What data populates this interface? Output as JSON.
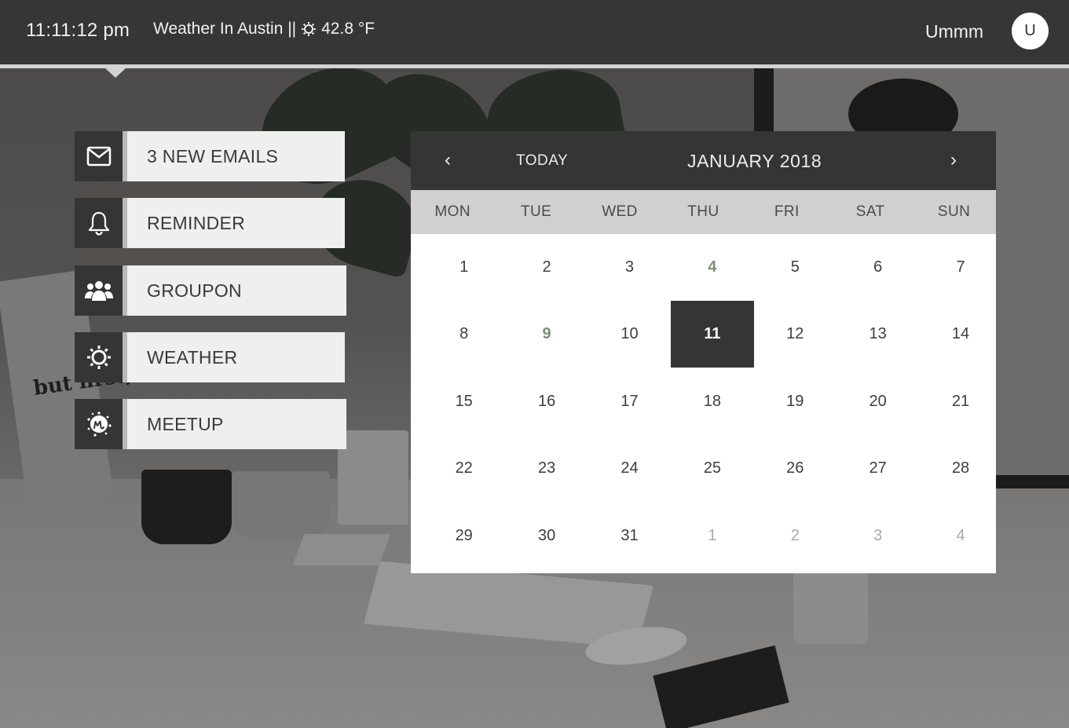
{
  "topbar": {
    "time": "11:11:12 pm",
    "weather_label": "Weather In Austin ||",
    "weather_icon": "sun-icon",
    "temperature": "42.8 °F",
    "user_name": "Ummm",
    "avatar_initial": "U"
  },
  "tiles": [
    {
      "label": "3 NEW EMAILS",
      "icon": "envelope-icon"
    },
    {
      "label": "REMINDER",
      "icon": "bell-icon"
    },
    {
      "label": "GROUPON",
      "icon": "group-icon"
    },
    {
      "label": "WEATHER",
      "icon": "sun-icon"
    },
    {
      "label": "MEETUP",
      "icon": "meetup-icon"
    }
  ],
  "calendar": {
    "prev_label": "‹",
    "today_label": "TODAY",
    "month_label": "JANUARY 2018",
    "next_label": "›",
    "weekdays": [
      "MON",
      "TUE",
      "WED",
      "THU",
      "FRI",
      "SAT",
      "SUN"
    ],
    "weeks": [
      [
        {
          "d": "1"
        },
        {
          "d": "2"
        },
        {
          "d": "3"
        },
        {
          "d": "4",
          "s": "event"
        },
        {
          "d": "5"
        },
        {
          "d": "6"
        },
        {
          "d": "7"
        }
      ],
      [
        {
          "d": "8"
        },
        {
          "d": "9",
          "s": "event"
        },
        {
          "d": "10"
        },
        {
          "d": "11",
          "s": "selected"
        },
        {
          "d": "12"
        },
        {
          "d": "13"
        },
        {
          "d": "14"
        }
      ],
      [
        {
          "d": "15"
        },
        {
          "d": "16"
        },
        {
          "d": "17"
        },
        {
          "d": "18"
        },
        {
          "d": "19"
        },
        {
          "d": "20"
        },
        {
          "d": "21"
        }
      ],
      [
        {
          "d": "22"
        },
        {
          "d": "23"
        },
        {
          "d": "24"
        },
        {
          "d": "25"
        },
        {
          "d": "26"
        },
        {
          "d": "27"
        },
        {
          "d": "28"
        }
      ],
      [
        {
          "d": "29"
        },
        {
          "d": "30"
        },
        {
          "d": "31"
        },
        {
          "d": "1",
          "s": "other"
        },
        {
          "d": "2",
          "s": "other"
        },
        {
          "d": "3",
          "s": "other"
        },
        {
          "d": "4",
          "s": "other"
        }
      ]
    ]
  },
  "background": {
    "poster_text": "but first, Co"
  },
  "colors": {
    "bar": "#363636",
    "tile_bg": "#efefef",
    "event_day": "#7c8f74",
    "selected_day": "#353535"
  }
}
